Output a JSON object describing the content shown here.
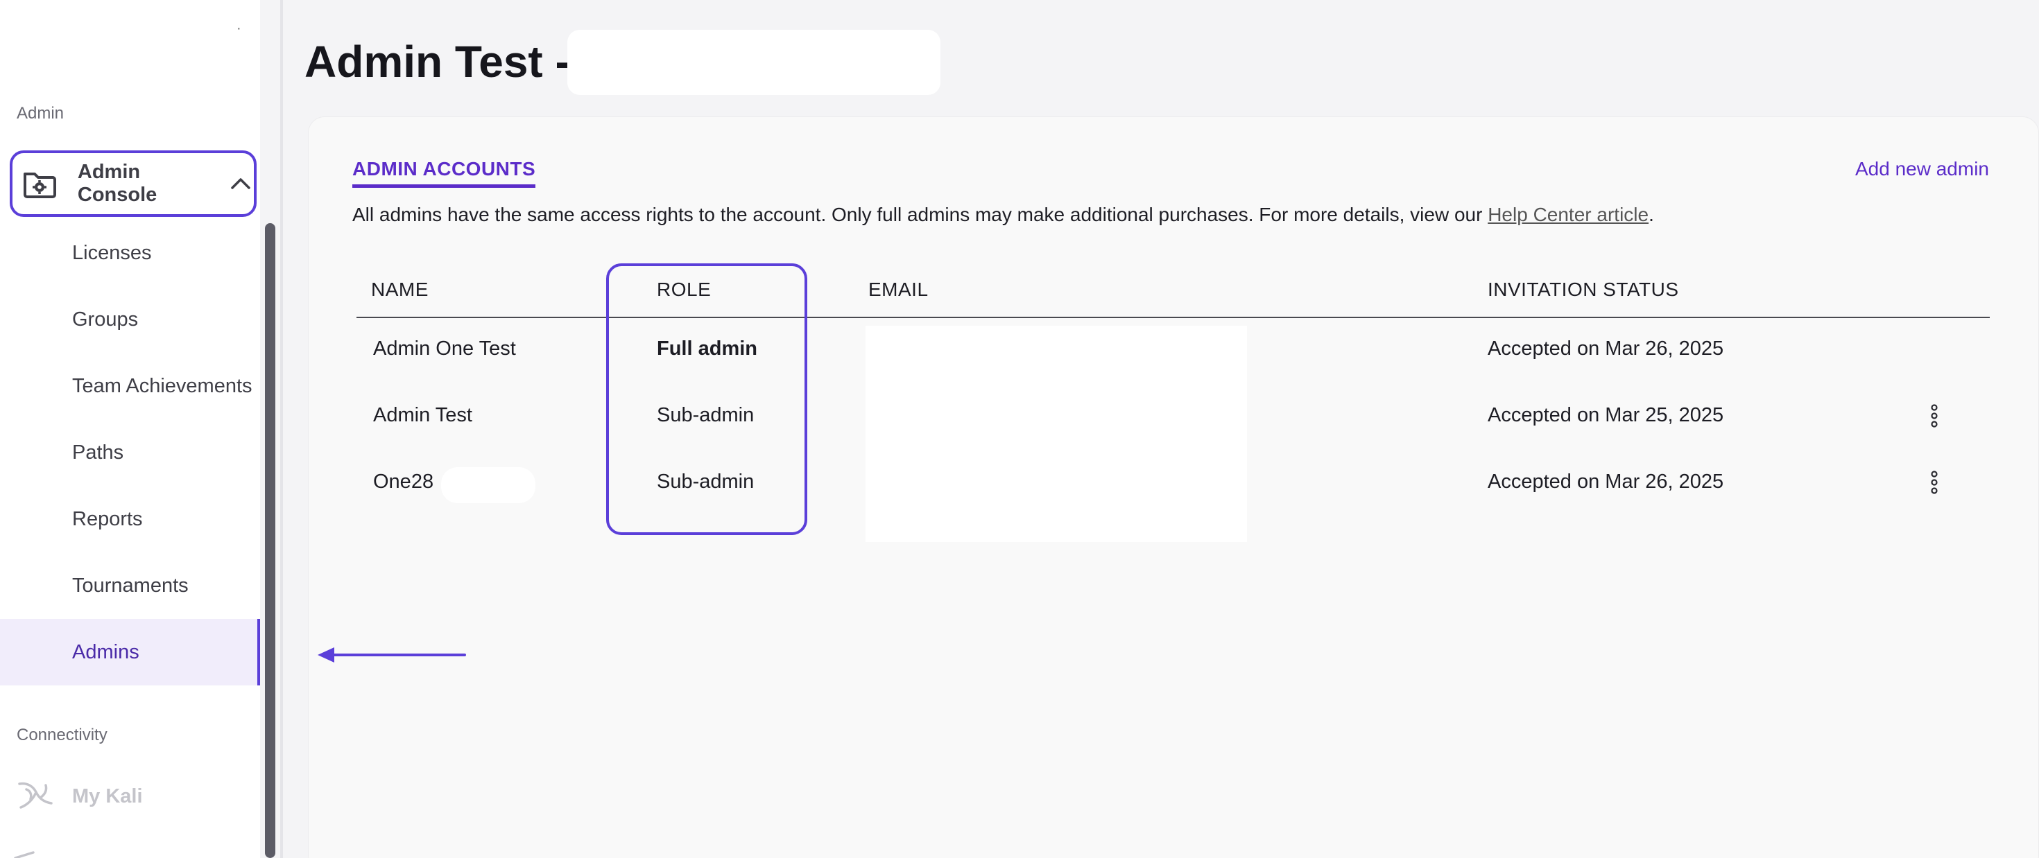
{
  "sidebar": {
    "section_admin": "Admin",
    "console_label": "Admin Console",
    "items": [
      {
        "label": "Licenses"
      },
      {
        "label": "Groups"
      },
      {
        "label": "Team Achievements"
      },
      {
        "label": "Paths"
      },
      {
        "label": "Reports"
      },
      {
        "label": "Tournaments"
      },
      {
        "label": "Admins",
        "active": true
      }
    ],
    "section_connectivity": "Connectivity",
    "kali_label": "My Kali",
    "icons": {
      "console": "folder-gear-icon",
      "console_toggle": "chevron-up-icon",
      "kali": "kali-dragon-icon"
    }
  },
  "header": {
    "title": "Admin Test -"
  },
  "card": {
    "tab_label": "ADMIN ACCOUNTS",
    "add_admin_label": "Add new admin",
    "description_text": "All admins have the same access rights to the account. Only full admins may make additional purchases. For more details, view our ",
    "help_link_label": "Help Center article",
    "description_end": ".",
    "table": {
      "headers": {
        "name": "NAME",
        "role": "ROLE",
        "email": "EMAIL",
        "status": "INVITATION STATUS"
      },
      "rows": [
        {
          "name": "Admin One Test",
          "role": "Full admin",
          "status": "Accepted on Mar 26, 2025"
        },
        {
          "name": "Admin Test",
          "role": "Sub-admin",
          "status": "Accepted on Mar 25, 2025"
        },
        {
          "name": "One28",
          "role": "Sub-admin",
          "status": "Accepted on Mar 26, 2025"
        }
      ]
    }
  },
  "colors": {
    "accent": "#5b2cc9",
    "highlight_border": "#5b3fd9",
    "active_nav_bg": "#f1edfb"
  }
}
